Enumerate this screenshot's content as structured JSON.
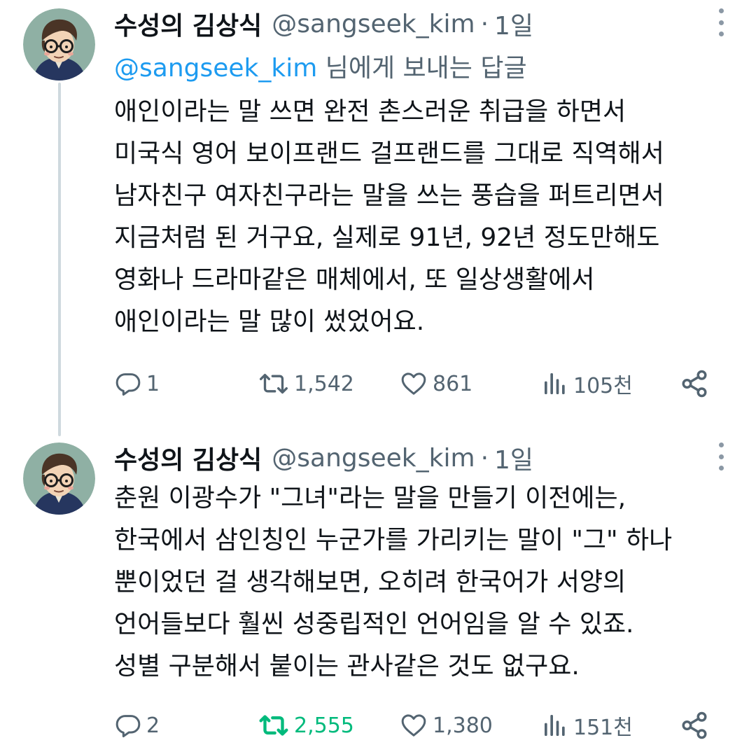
{
  "tweets": [
    {
      "display_name": "수성의 김상식",
      "handle": "@sangseek_kim",
      "separator": "·",
      "time": "1일",
      "reply_prefix": "@sangseek_kim",
      "reply_suffix": " 님에게 보내는 답글",
      "lines": [
        "애인이라는 말 쓰면 완전 촌스러운 취급을 하면서",
        "미국식 영어 보이프랜드 걸프랜드를 그대로 직역해서",
        "남자친구 여자친구라는 말을 쓰는 풍습을 퍼트리면서",
        "지금처럼 된 거구요, 실제로 91년, 92년 정도만해도",
        "영화나 드라마같은 매체에서, 또 일상생활에서",
        "애인이라는 말 많이 썼었어요."
      ],
      "stats": {
        "replies": "1",
        "retweets": "1,542",
        "likes": "861",
        "views": "105천"
      },
      "retweeted": false
    },
    {
      "display_name": "수성의 김상식",
      "handle": "@sangseek_kim",
      "separator": "·",
      "time": "1일",
      "lines": [
        "춘원 이광수가 \"그녀\"라는 말을 만들기 이전에는,",
        "한국에서 삼인칭인 누군가를 가리키는 말이 \"그\" 하나",
        "뿐이었던 걸 생각해보면, 오히려 한국어가 서양의",
        "언어들보다 훨씬 성중립적인 언어임을 알 수 있죠.",
        "성별 구분해서 붙이는 관사같은 것도 없구요."
      ],
      "stats": {
        "replies": "2",
        "retweets": "2,555",
        "likes": "1,380",
        "views": "151천"
      },
      "retweeted": true
    }
  ],
  "icons": {
    "reply": "reply-icon",
    "retweet": "retweet-icon",
    "like": "heart-icon",
    "views": "views-icon",
    "share": "share-icon",
    "more": "more-vertical-icon"
  },
  "colors": {
    "text": "#0f1419",
    "secondary": "#536471",
    "link": "#1d9bf0",
    "retweet_active": "#00ba7c",
    "thread_line": "#cfd9de"
  }
}
